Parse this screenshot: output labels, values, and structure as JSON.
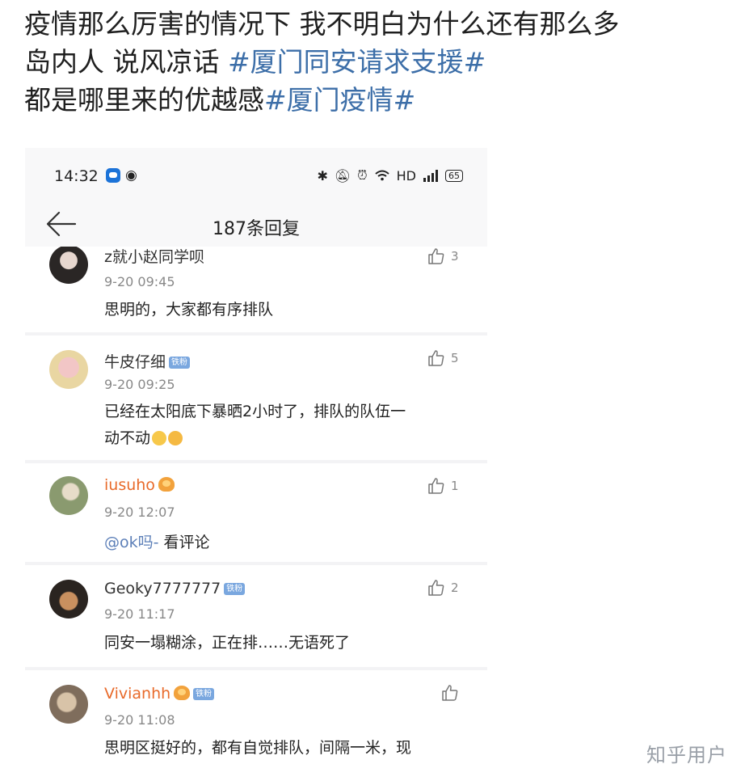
{
  "post": {
    "line1": "疫情那么厉害的情况下 我不明白为什么还有那么多",
    "line2_text": "岛内人 说风凉话 ",
    "line2_tag": "#厦门同安请求支援#",
    "line3_text": "都是哪里来的优越感",
    "line3_tag": "#厦门疫情#"
  },
  "status_bar": {
    "time": "14:32",
    "network": "HD",
    "battery": "65"
  },
  "nav": {
    "title": "187条回复"
  },
  "comments": [
    {
      "username": "z就小赵同学呗",
      "time": "9-20 09:45",
      "content": "思明的，大家都有序排队",
      "likes": "3"
    },
    {
      "username": "牛皮仔细",
      "badge": "铁粉",
      "time": "9-20 09:25",
      "content_line1": "已经在太阳底下暴晒2小时了，排队的队伍一",
      "content_line2": "动不动",
      "likes": "5"
    },
    {
      "username": "iusuho",
      "time": "9-20 12:07",
      "mention": "@ok吗-",
      "content": " 看评论",
      "likes": "1"
    },
    {
      "username": "Geoky7777777",
      "badge": "铁粉",
      "time": "9-20 11:17",
      "content": "同安一塌糊涂，正在排……无语死了",
      "likes": "2"
    },
    {
      "username": "Vivianhh",
      "badge": "铁粉",
      "time": "9-20 11:08",
      "content": "思明区挺好的，都有自觉排队，间隔一米，现"
    }
  ],
  "watermark": "知乎用户",
  "colors": {
    "hashtag": "#3c6ea8",
    "vip_name": "#e86a2a",
    "badge": "#7aa7df",
    "mention": "#5c7fb8"
  },
  "icons": [
    "back-arrow-icon",
    "like-icon",
    "bluetooth-icon",
    "mute-icon",
    "alarm-icon",
    "wifi-icon",
    "signal-icon",
    "battery-icon",
    "weibo-icon"
  ]
}
